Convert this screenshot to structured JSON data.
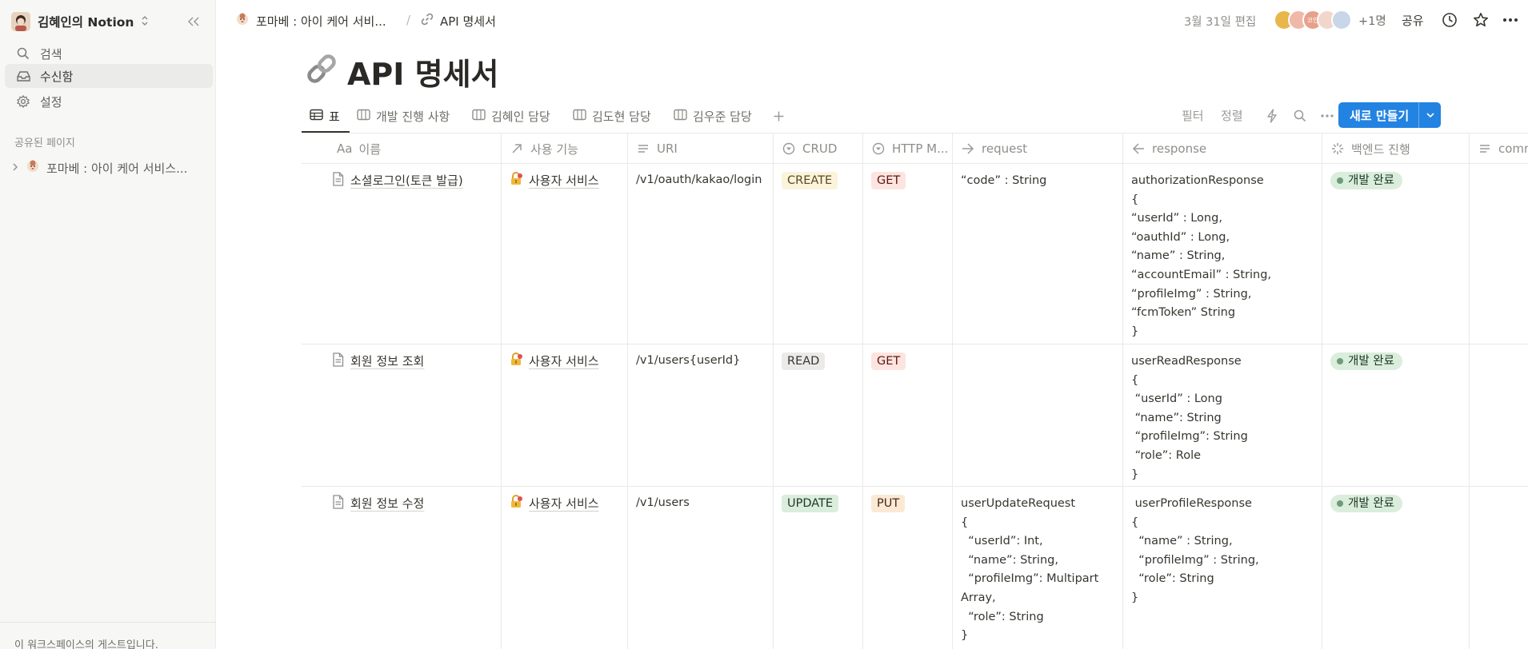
{
  "sidebar": {
    "workspace_name": "김혜인의 Notion",
    "nav": [
      {
        "label": "검색",
        "icon": "search-icon"
      },
      {
        "label": "수신함",
        "icon": "inbox-icon"
      },
      {
        "label": "설정",
        "icon": "settings-icon"
      }
    ],
    "shared_section_label": "공유된 페이지",
    "shared_pages": [
      {
        "label": "포마베 : 아이 케어 서비스..."
      }
    ],
    "footer_text": "이 워크스페이스의 게스트입니다."
  },
  "topbar": {
    "breadcrumb": [
      {
        "label": "포마베 : 아이 케어 서비..."
      },
      {
        "label": "API 명세서"
      }
    ],
    "breadcrumb_sep": "/",
    "edited": "3월 31일 편집",
    "avatar_colors": [
      "#e8b64a",
      "#f0b8a8",
      "#e8a08a",
      "#f2d6cc",
      "#c9d6e8"
    ],
    "avatar_labels": [
      "",
      "",
      "코인",
      "",
      ""
    ],
    "extra_members": "+1명",
    "share_label": "공유"
  },
  "page": {
    "title": "API 명세서"
  },
  "views": {
    "tabs": [
      {
        "label": "표",
        "icon": "table-icon"
      },
      {
        "label": "개발 진행 사항",
        "icon": "board-icon"
      },
      {
        "label": "김혜인 담당",
        "icon": "board-icon"
      },
      {
        "label": "김도현 담당",
        "icon": "board-icon"
      },
      {
        "label": "김우준 담당",
        "icon": "board-icon"
      }
    ],
    "filter_label": "필터",
    "sort_label": "정렬",
    "new_label": "새로 만들기"
  },
  "table": {
    "columns": [
      {
        "label": "이름",
        "prefix": "Aa"
      },
      {
        "label": "사용 기능"
      },
      {
        "label": "URI"
      },
      {
        "label": "CRUD"
      },
      {
        "label": "HTTP M..."
      },
      {
        "label": "request"
      },
      {
        "label": "response"
      },
      {
        "label": "백엔드 진행"
      },
      {
        "label": "comm"
      }
    ],
    "rows": [
      {
        "name": "소셜로그인(토큰 발급)",
        "feature": "사용자 서비스",
        "uri": "/v1/oauth/kakao/login",
        "crud": "CREATE",
        "method": "GET",
        "request": "“code” : String",
        "response": "authorizationResponse\n{\n“userId” : Long,\n“oauthId” : Long,\n“name” : String,\n“accountEmail” : String,\n“profileImg” : String,\n“fcmToken” String\n}",
        "status": "개발 완료"
      },
      {
        "name": "회원 정보 조회",
        "feature": "사용자 서비스",
        "uri": "/v1/users{userId}",
        "crud": "READ",
        "method": "GET",
        "request": "",
        "response": "userReadResponse\n{\n “userId” : Long\n “name”: String\n “profileImg”: String\n “role”: Role\n}",
        "status": "개발 완료"
      },
      {
        "name": "회원 정보 수정",
        "feature": "사용자 서비스",
        "uri": "/v1/users",
        "crud": "UPDATE",
        "method": "PUT",
        "request": "userUpdateRequest\n{\n  “userId”: Int,\n  “name”: String,\n  “profileImg”: Multipart\nArray,\n  “role”: String\n}",
        "response": " userProfileResponse\n{\n  “name” : String,\n  “profileImg” : String,\n  “role”: String\n}",
        "status": "개발 완료"
      }
    ]
  }
}
